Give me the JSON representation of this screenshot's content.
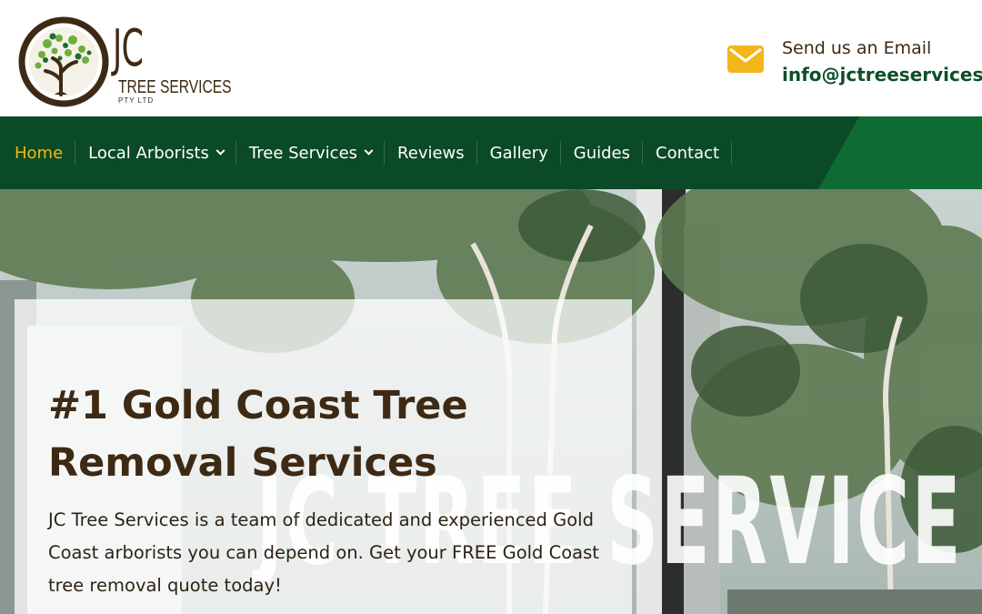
{
  "brand": {
    "logo_main": "JC",
    "logo_sub": "TREE SERVICES",
    "logo_pty": "PTY LTD",
    "colors": {
      "brown": "#3e2a14",
      "green_dark": "#0b4a26",
      "green_accent": "#0e6b34",
      "gold": "#f3b619"
    }
  },
  "contact": {
    "icon": "envelope-icon",
    "label": "Send us an Email",
    "email": "info@jctreeservices.c"
  },
  "nav": {
    "items": [
      {
        "label": "Home",
        "active": true
      },
      {
        "label": "Local Arborists",
        "dropdown": true
      },
      {
        "label": "Tree Services",
        "dropdown": true
      },
      {
        "label": "Reviews"
      },
      {
        "label": "Gallery"
      },
      {
        "label": "Guides"
      },
      {
        "label": "Contact"
      }
    ]
  },
  "hero": {
    "title": "#1 Gold Coast Tree Removal Services",
    "text": "JC Tree Services is a team of dedicated and experienced Gold Coast arborists you can depend on. Get your FREE Gold Coast tree removal quote today!",
    "watermark": "JC TREE SERVICE"
  }
}
